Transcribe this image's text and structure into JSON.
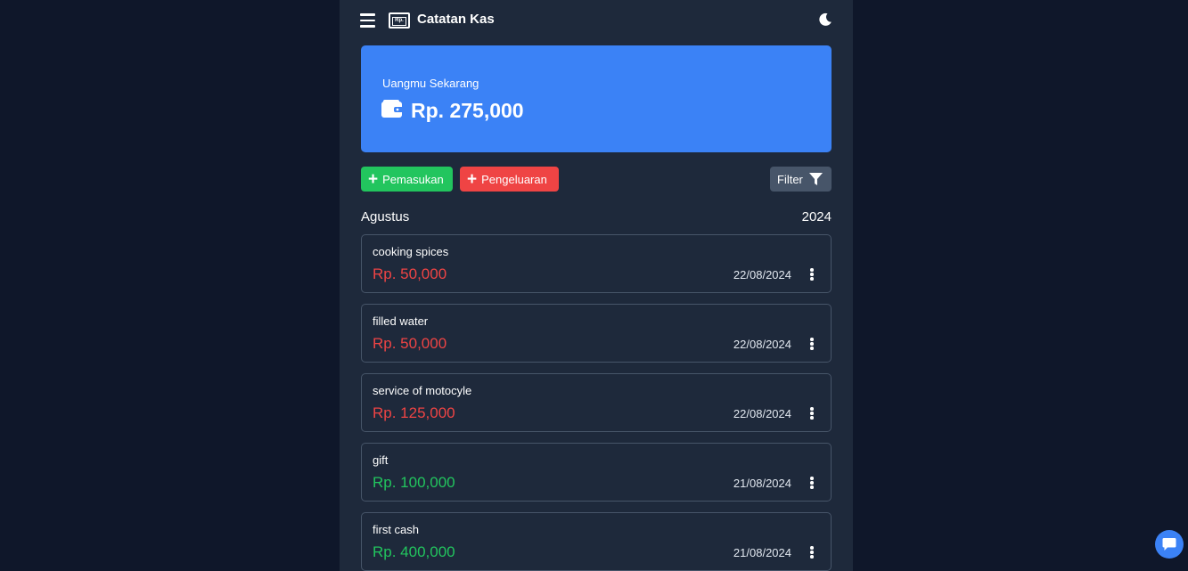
{
  "header": {
    "title": "Catatan Kas",
    "logo_text": "Rp."
  },
  "balance": {
    "label": "Uangmu Sekarang",
    "amount": "Rp. 275,000"
  },
  "actions": {
    "income_label": "Pemasukan",
    "expense_label": "Pengeluaran",
    "filter_label": "Filter"
  },
  "period": {
    "month": "Agustus",
    "year": "2024"
  },
  "transactions": [
    {
      "name": "cooking spices",
      "amount": "Rp. 50,000",
      "date": "22/08/2024",
      "type": "expense"
    },
    {
      "name": "filled water",
      "amount": "Rp. 50,000",
      "date": "22/08/2024",
      "type": "expense"
    },
    {
      "name": "service of motocyle",
      "amount": "Rp. 125,000",
      "date": "22/08/2024",
      "type": "expense"
    },
    {
      "name": "gift",
      "amount": "Rp. 100,000",
      "date": "21/08/2024",
      "type": "income"
    },
    {
      "name": "first cash",
      "amount": "Rp. 400,000",
      "date": "21/08/2024",
      "type": "income"
    }
  ],
  "colors": {
    "background": "#0f172a",
    "panel": "#1e293b",
    "accent": "#3b82f6",
    "income": "#22c55e",
    "expense": "#ef4444",
    "filter_button": "#475569"
  },
  "icons": {
    "menu": "hamburger-icon",
    "logo": "money-bill-icon",
    "theme": "moon-icon",
    "wallet": "wallet-icon",
    "add": "plus-icon",
    "filter": "filter-icon",
    "row_menu": "ellipsis-vertical-icon",
    "chat": "chat-icon"
  }
}
